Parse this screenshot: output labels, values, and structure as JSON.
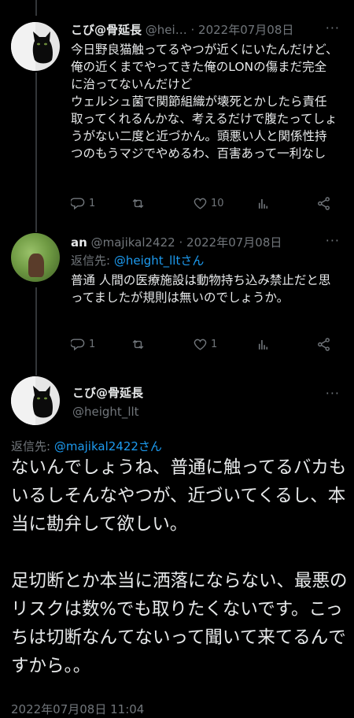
{
  "tweet1": {
    "name": "こび@骨延長",
    "handle": "@hei…",
    "separator": " · ",
    "date": "2022年07月08日",
    "text": "今日野良猫触ってるやつが近くにいたんだけど、俺の近くまでやってきた俺のLONの傷まだ完全に治ってないんだけど\nウェルシュ菌で関節組織が壊死とかしたら責任取ってくれるんかな、考えるだけで腹たってしょうがない二度と近づかん。頭悪い人と関係性持つのもうマジでやめるわ、百害あって一利なし",
    "reply_count": "1",
    "retweet_count": "",
    "like_count": "10"
  },
  "tweet2": {
    "name": "an",
    "handle": "@majikal2422",
    "separator": " · ",
    "date": "2022年07月08日",
    "reply_label": "返信先: ",
    "reply_target": "@height_lltさん",
    "text": "普通 人間の医療施設は動物持ち込み禁止だと思ってましたが規則は無いのでしょうか。",
    "reply_count": "1",
    "retweet_count": "",
    "like_count": "1"
  },
  "main_tweet": {
    "name": "こび@骨延長",
    "handle": "@height_llt",
    "reply_label": "返信先: ",
    "reply_target": "@majikal2422さん",
    "text": "ないんでしょうね、普通に触ってるバカもいるしそんなやつが、近づいてくるし、本当に勘弁して欲しい。\n\n足切断とか本当に洒落にならない、最悪のリスクは数%でも取りたくないです。こっちは切断なんてないって聞いて来てるんですから。。",
    "timestamp": "2022年07月08日 11:04"
  },
  "icons": {
    "reply": "reply-icon",
    "retweet": "retweet-icon",
    "like": "heart-icon",
    "views": "analytics-icon",
    "share": "share-icon",
    "more": "more-icon"
  },
  "colors": {
    "background": "#000000",
    "text": "#e7e9ea",
    "muted": "#71767b",
    "link": "#1d9bf0"
  }
}
